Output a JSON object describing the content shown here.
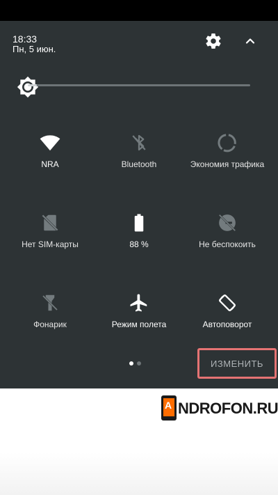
{
  "status": {
    "time": "18:33",
    "date": "Пн, 5 июн."
  },
  "header": {
    "settings_icon": "gear-icon",
    "collapse_icon": "chevron-up-icon"
  },
  "brightness": {
    "icon": "brightness-icon",
    "level_percent": 4
  },
  "tiles": [
    {
      "label": "NRA",
      "icon": "wifi-icon",
      "active": true
    },
    {
      "label": "Bluetooth",
      "icon": "bluetooth-off-icon",
      "active": false
    },
    {
      "label": "Экономия трафика",
      "icon": "data-saver-icon",
      "active": false
    },
    {
      "label": "Нет SIM-карты",
      "icon": "no-sim-icon",
      "active": false
    },
    {
      "label": "88 %",
      "icon": "battery-icon",
      "active": true
    },
    {
      "label": "Не беспокоить",
      "icon": "dnd-off-icon",
      "active": false
    },
    {
      "label": "Фонарик",
      "icon": "flashlight-off-icon",
      "active": false
    },
    {
      "label": "Режим полета",
      "icon": "airplane-icon",
      "active": true
    },
    {
      "label": "Автоповорот",
      "icon": "auto-rotate-icon",
      "active": true
    }
  ],
  "pager": {
    "current": 1,
    "total": 2
  },
  "edit_button": {
    "label": "ИЗМЕНИТЬ"
  },
  "watermark": {
    "letter": "A",
    "rest": "NDROFON.RU"
  },
  "colors": {
    "shade_bg": "#2d3335",
    "accent_highlight": "#e57373",
    "icon_active": "#ffffff",
    "icon_dim": "#737b7e"
  }
}
